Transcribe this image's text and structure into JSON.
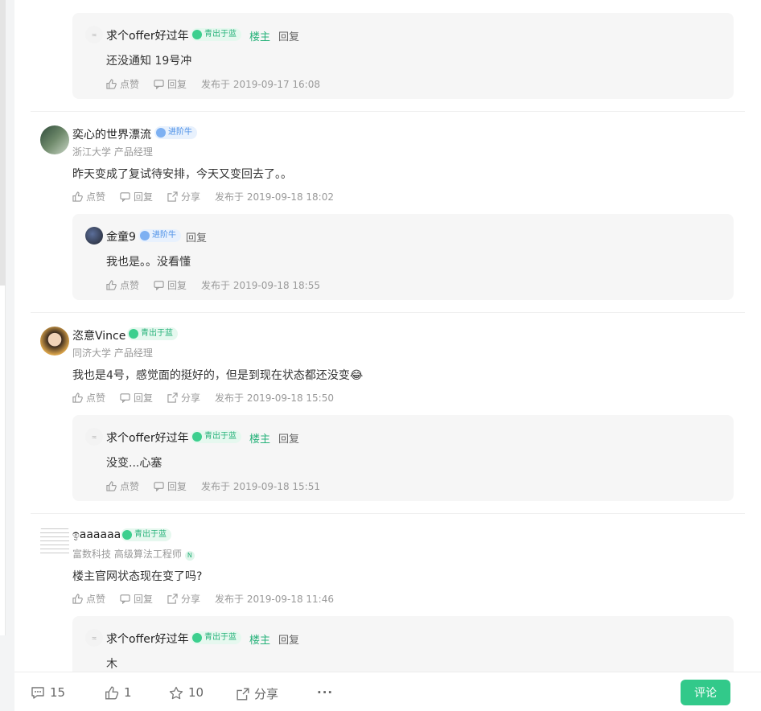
{
  "colors": {
    "accent": "#32c98a",
    "owner_green": "#27b27a",
    "badge_blue": "#4a8fe7"
  },
  "threads": [
    {
      "replies": [
        {
          "name": "求个offer好过年",
          "badge": "青出于蓝",
          "badge_color": "green",
          "owner": "楼主",
          "reply_label": "回复",
          "content": "还没通知 19号冲",
          "like": "点赞",
          "reply": "回复",
          "time": "发布于 2019-09-17 16:08"
        }
      ]
    },
    {
      "name": "奕心的世界漂流",
      "badge": "进阶牛",
      "badge_color": "blue",
      "school": "浙江大学 产品经理",
      "content": "昨天变成了复试待安排，今天又变回去了。。",
      "like": "点赞",
      "reply": "回复",
      "share": "分享",
      "time": "发布于 2019-09-18 18:02",
      "replies": [
        {
          "name": "金童9",
          "badge": "进阶牛",
          "badge_color": "blue",
          "reply_label": "回复",
          "content": "我也是。。没看懂",
          "like": "点赞",
          "reply": "回复",
          "time": "发布于 2019-09-18 18:55"
        }
      ]
    },
    {
      "name": "恣意Vince",
      "badge": "青出于蓝",
      "badge_color": "green",
      "school": "同济大学 产品经理",
      "content": "我也是4号，感觉面的挺好的，但是到现在状态都还没变😂",
      "like": "点赞",
      "reply": "回复",
      "share": "分享",
      "time": "发布于 2019-09-18 15:50",
      "replies": [
        {
          "name": "求个offer好过年",
          "badge": "青出于蓝",
          "badge_color": "green",
          "owner": "楼主",
          "reply_label": "回复",
          "content": "没变...心塞",
          "like": "点赞",
          "reply": "回复",
          "time": "发布于 2019-09-18 15:51"
        }
      ]
    },
    {
      "name": "ඉaaaaaa",
      "badge": "青出于蓝",
      "badge_color": "green",
      "school": "富数科技 高级算法工程师",
      "school_badge": "N",
      "content": "楼主官网状态现在变了吗?",
      "like": "点赞",
      "reply": "回复",
      "share": "分享",
      "time": "发布于 2019-09-18 11:46",
      "replies": [
        {
          "name": "求个offer好过年",
          "badge": "青出于蓝",
          "badge_color": "green",
          "owner": "楼主",
          "reply_label": "回复",
          "content": "木"
        }
      ]
    }
  ],
  "bottom_bar": {
    "comments": "15",
    "likes": "1",
    "stars": "10",
    "share": "分享",
    "more": "···",
    "comment_button": "评论"
  }
}
